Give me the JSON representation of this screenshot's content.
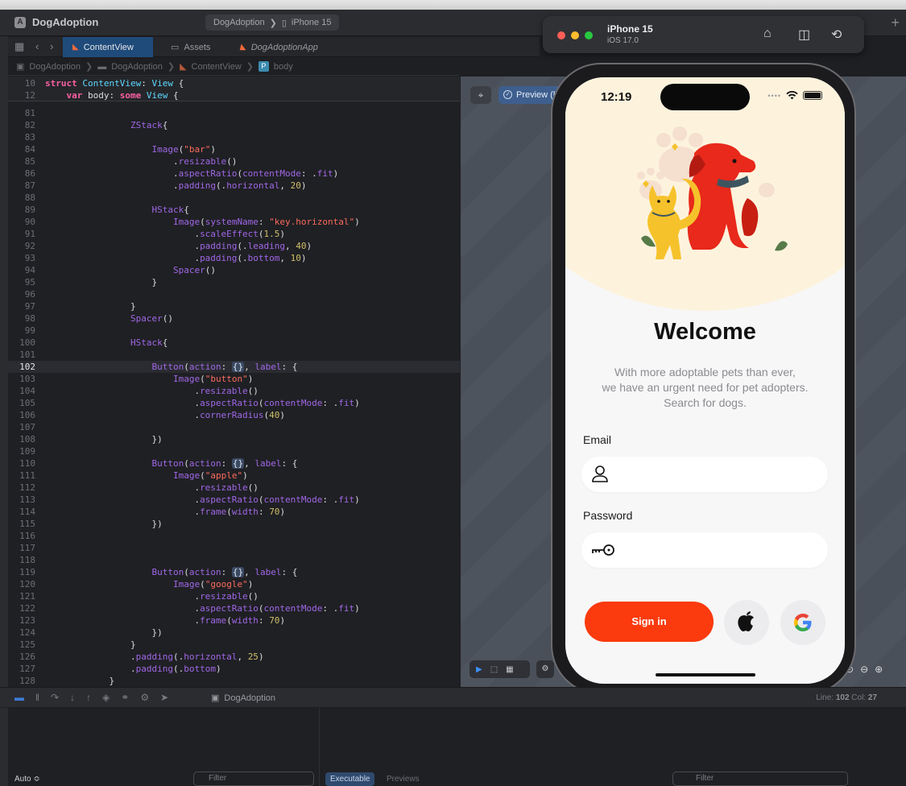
{
  "window": {
    "app_name": "DogAdoption",
    "scheme_target": "DogAdoption",
    "device": "iPhone 15"
  },
  "tabs": [
    {
      "label": "ContentView"
    },
    {
      "label": "Assets"
    },
    {
      "label": "DogAdoptionApp"
    }
  ],
  "breadcrumb": [
    "DogAdoption",
    "DogAdoption",
    "ContentView",
    "body"
  ],
  "code": {
    "sticky": [
      {
        "n": "10",
        "html": "<span class=\"kw\">struct</span> <span class=\"ty\">ContentView</span>: <span class=\"ty\">View</span> {"
      },
      {
        "n": "12",
        "html": "    <span class=\"kw\">var</span> body: <span class=\"kw\">some</span> <span class=\"ty\">View</span> {"
      }
    ],
    "lines": [
      {
        "n": "81",
        "html": ""
      },
      {
        "n": "82",
        "html": "                <span class=\"fn\">ZStack</span>{"
      },
      {
        "n": "83",
        "html": ""
      },
      {
        "n": "84",
        "html": "                    <span class=\"fn\">Image</span>(<span class=\"str\">\"bar\"</span>)"
      },
      {
        "n": "85",
        "html": "                        .<span class=\"fn\">resizable</span>()"
      },
      {
        "n": "86",
        "html": "                        .<span class=\"fn\">aspectRatio</span>(<span class=\"fn\">contentMode</span>: .<span class=\"fn\">fit</span>)"
      },
      {
        "n": "87",
        "html": "                        .<span class=\"fn\">padding</span>(.<span class=\"fn\">horizontal</span>, <span class=\"num\">20</span>)"
      },
      {
        "n": "88",
        "html": ""
      },
      {
        "n": "89",
        "html": "                    <span class=\"fn\">HStack</span>{"
      },
      {
        "n": "90",
        "html": "                        <span class=\"fn\">Image</span>(<span class=\"fn\">systemName</span>: <span class=\"str\">\"key.horizontal\"</span>)"
      },
      {
        "n": "91",
        "html": "                            .<span class=\"fn\">scaleEffect</span>(<span class=\"num\">1.5</span>)"
      },
      {
        "n": "92",
        "html": "                            .<span class=\"fn\">padding</span>(.<span class=\"fn\">leading</span>, <span class=\"num\">40</span>)"
      },
      {
        "n": "93",
        "html": "                            .<span class=\"fn\">padding</span>(.<span class=\"fn\">bottom</span>, <span class=\"num\">10</span>)"
      },
      {
        "n": "94",
        "html": "                        <span class=\"fn\">Spacer</span>()"
      },
      {
        "n": "95",
        "html": "                    }"
      },
      {
        "n": "96",
        "html": ""
      },
      {
        "n": "97",
        "html": "                }"
      },
      {
        "n": "98",
        "html": "                <span class=\"fn\">Spacer</span>()"
      },
      {
        "n": "99",
        "html": ""
      },
      {
        "n": "100",
        "html": "                <span class=\"fn\">HStack</span>{"
      },
      {
        "n": "101",
        "html": ""
      },
      {
        "n": "102",
        "html": "                    <span class=\"fn\">Button</span>(<span class=\"fn\">action</span>: <span class=\"ph\">{}</span>, <span class=\"fn\">label</span>: {",
        "current": true
      },
      {
        "n": "103",
        "html": "                        <span class=\"fn\">Image</span>(<span class=\"str\">\"button\"</span>)"
      },
      {
        "n": "104",
        "html": "                            .<span class=\"fn\">resizable</span>()"
      },
      {
        "n": "105",
        "html": "                            .<span class=\"fn\">aspectRatio</span>(<span class=\"fn\">contentMode</span>: .<span class=\"fn\">fit</span>)"
      },
      {
        "n": "106",
        "html": "                            .<span class=\"fn\">cornerRadius</span>(<span class=\"num\">40</span>)"
      },
      {
        "n": "107",
        "html": ""
      },
      {
        "n": "108",
        "html": "                    })"
      },
      {
        "n": "109",
        "html": ""
      },
      {
        "n": "110",
        "html": "                    <span class=\"fn\">Button</span>(<span class=\"fn\">action</span>: <span class=\"ph\">{}</span>, <span class=\"fn\">label</span>: {"
      },
      {
        "n": "111",
        "html": "                        <span class=\"fn\">Image</span>(<span class=\"str\">\"apple\"</span>)"
      },
      {
        "n": "112",
        "html": "                            .<span class=\"fn\">resizable</span>()"
      },
      {
        "n": "113",
        "html": "                            .<span class=\"fn\">aspectRatio</span>(<span class=\"fn\">contentMode</span>: .<span class=\"fn\">fit</span>)"
      },
      {
        "n": "114",
        "html": "                            .<span class=\"fn\">frame</span>(<span class=\"fn\">width</span>: <span class=\"num\">70</span>)"
      },
      {
        "n": "115",
        "html": "                    })"
      },
      {
        "n": "116",
        "html": ""
      },
      {
        "n": "117",
        "html": ""
      },
      {
        "n": "118",
        "html": ""
      },
      {
        "n": "119",
        "html": "                    <span class=\"fn\">Button</span>(<span class=\"fn\">action</span>: <span class=\"ph\">{}</span>, <span class=\"fn\">label</span>: {"
      },
      {
        "n": "120",
        "html": "                        <span class=\"fn\">Image</span>(<span class=\"str\">\"google\"</span>)"
      },
      {
        "n": "121",
        "html": "                            .<span class=\"fn\">resizable</span>()"
      },
      {
        "n": "122",
        "html": "                            .<span class=\"fn\">aspectRatio</span>(<span class=\"fn\">contentMode</span>: .<span class=\"fn\">fit</span>)"
      },
      {
        "n": "123",
        "html": "                            .<span class=\"fn\">frame</span>(<span class=\"fn\">width</span>: <span class=\"num\">70</span>)"
      },
      {
        "n": "124",
        "html": "                    })"
      },
      {
        "n": "125",
        "html": "                }"
      },
      {
        "n": "126",
        "html": "                .<span class=\"fn\">padding</span>(.<span class=\"fn\">horizontal</span>, <span class=\"num\">25</span>)"
      },
      {
        "n": "127",
        "html": "                .<span class=\"fn\">padding</span>(.<span class=\"fn\">bottom</span>)"
      },
      {
        "n": "128",
        "html": "            }"
      }
    ]
  },
  "canvas": {
    "preview_label": "Preview (l"
  },
  "simulator": {
    "device": "iPhone 15",
    "os": "iOS 17.0",
    "icons": [
      "home-icon",
      "screenshot-icon",
      "rotate-icon"
    ]
  },
  "app_screen": {
    "time": "12:19",
    "title": "Welcome",
    "subtitle_lines": [
      "With more adoptable pets than ever,",
      "we have an urgent need for pet adopters.",
      "Search for dogs."
    ],
    "email_label": "Email",
    "email_value": "",
    "password_label": "Password",
    "password_value": "",
    "signin_label": "Sign in",
    "colors": {
      "accent": "#fb3a0e",
      "hero_bg": "#fdf3dd",
      "dog": "#e8291b",
      "cat": "#f6c22b"
    }
  },
  "status_bar": {
    "scheme": "DogAdoption",
    "line_label": "Line:",
    "line_value": "102",
    "col_label": "Col:",
    "col_value": "27"
  },
  "debug": {
    "auto_label": "Auto ≎",
    "filter_placeholder": "Filter",
    "executable_label": "Executable",
    "previews_label": "Previews"
  }
}
